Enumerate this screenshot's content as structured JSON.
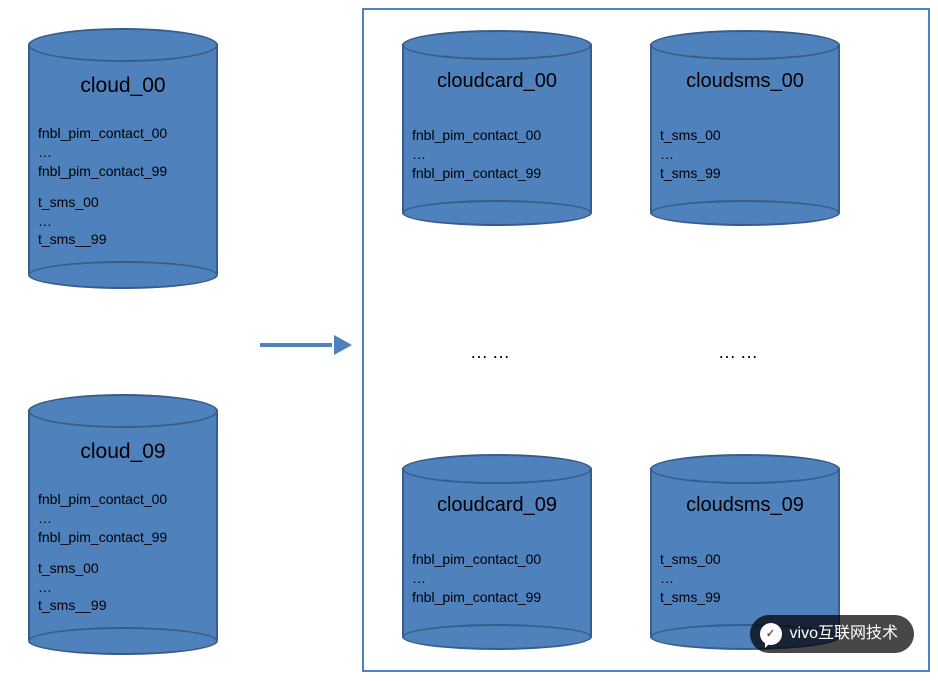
{
  "left": {
    "top": {
      "title": "cloud_00",
      "l1": "fnbl_pim_contact_00",
      "l2": "…",
      "l3": "fnbl_pim_contact_99",
      "l4": "t_sms_00",
      "l5": "…",
      "l6": "t_sms__99"
    },
    "bottom": {
      "title": "cloud_09",
      "l1": "fnbl_pim_contact_00",
      "l2": "…",
      "l3": "fnbl_pim_contact_99",
      "l4": "t_sms_00",
      "l5": "…",
      "l6": "t_sms__99"
    }
  },
  "right": {
    "card_top": {
      "title": "cloudcard_00",
      "l1": "fnbl_pim_contact_00",
      "l2": "…",
      "l3": "fnbl_pim_contact_99"
    },
    "card_bot": {
      "title": "cloudcard_09",
      "l1": "fnbl_pim_contact_00",
      "l2": "…",
      "l3": "fnbl_pim_contact_99"
    },
    "sms_top": {
      "title": "cloudsms_00",
      "l1": "t_sms_00",
      "l2": "…",
      "l3": "t_sms_99"
    },
    "sms_bot": {
      "title": "cloudsms_09",
      "l1": "t_sms_00",
      "l2": "…",
      "l3": "t_sms_99"
    }
  },
  "dots": "……",
  "watermark": {
    "text": "vivo互联网技术",
    "glyph": "✓"
  },
  "colors": {
    "fill": "#4f81bd",
    "stroke": "#385d8a"
  }
}
